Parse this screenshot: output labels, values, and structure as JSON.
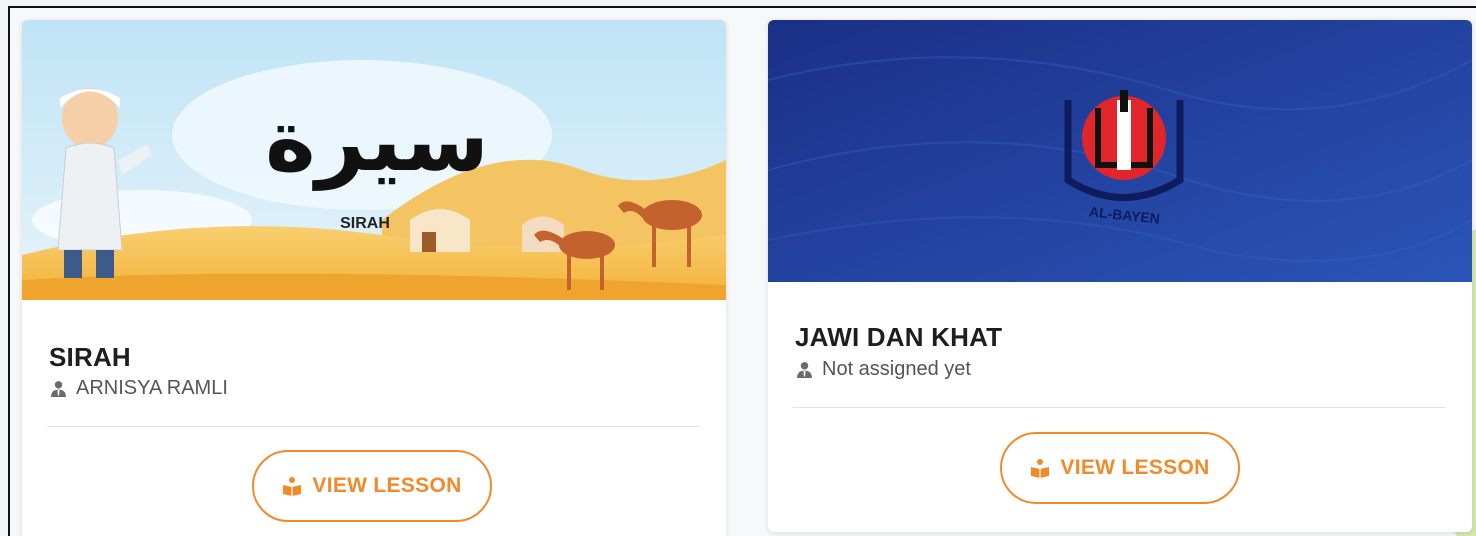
{
  "courses": [
    {
      "banner_title_arabic": "سيرة",
      "banner_subtitle": "SIRAH",
      "title": "SIRAH",
      "teacher": "ARNISYA RAMLI",
      "teacher_icon": "user-tie-icon",
      "button_label": "VIEW LESSON",
      "button_icon": "reading-icon"
    },
    {
      "logo_text": "AL-BAYEN",
      "title": "JAWI DAN KHAT",
      "teacher": "Not assigned yet",
      "teacher_icon": "user-tie-icon",
      "button_label": "VIEW LESSON",
      "button_icon": "reading-icon"
    }
  ],
  "colors": {
    "accent": "#f08a2b",
    "card2_banner": "#1f3f9c",
    "title_text": "#1e1e1e",
    "muted_text": "#555555"
  }
}
